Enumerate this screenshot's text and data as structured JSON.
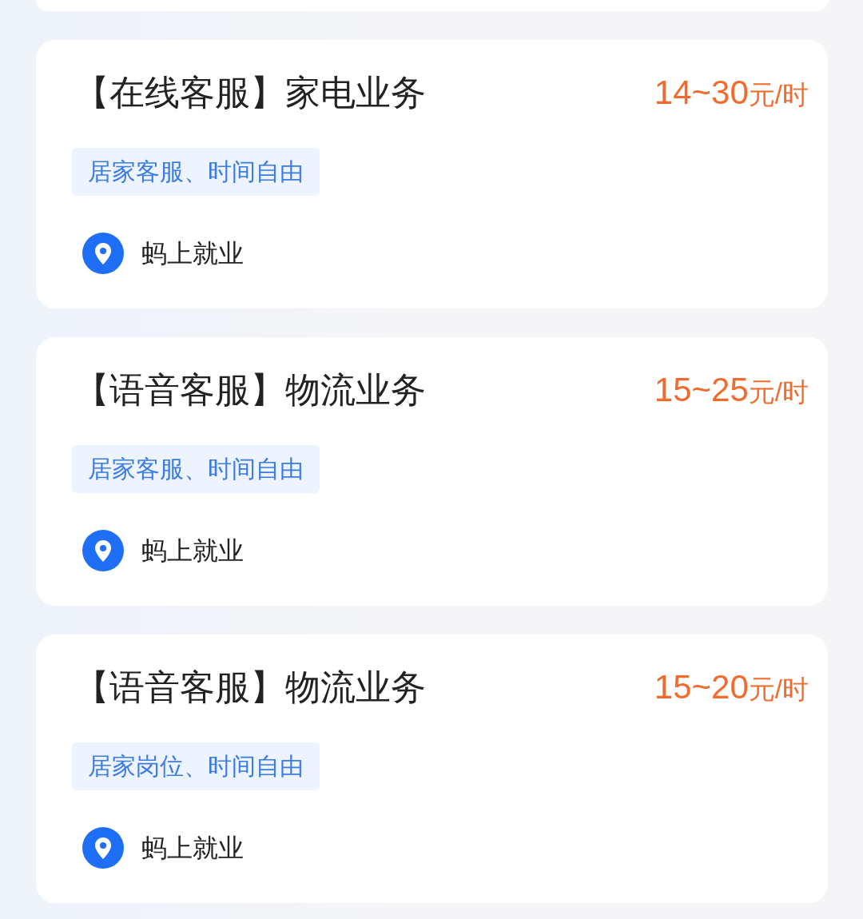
{
  "jobs": [
    {
      "title": "【在线客服】家电业务",
      "salary": "14~30",
      "unit": "元/时",
      "tag": "居家客服、时间自由",
      "company": "蚂上就业"
    },
    {
      "title": "【语音客服】物流业务",
      "salary": "15~25",
      "unit": "元/时",
      "tag": "居家客服、时间自由",
      "company": "蚂上就业"
    },
    {
      "title": "【语音客服】物流业务",
      "salary": "15~20",
      "unit": "元/时",
      "tag": "居家岗位、时间自由",
      "company": "蚂上就业"
    }
  ]
}
